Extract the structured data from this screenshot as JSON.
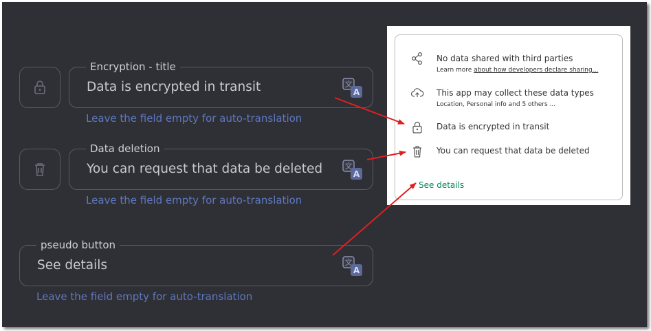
{
  "form": {
    "encryption": {
      "legend": "Encryption - title",
      "value": "Data is encrypted in transit",
      "hint": "Leave the field empty for auto-translation",
      "icon": "lock-icon"
    },
    "deletion": {
      "legend": "Data deletion",
      "value": "You can request that data be deleted",
      "hint": "Leave the field empty for auto-translation",
      "icon": "trash-icon"
    },
    "pseudo_button": {
      "legend": "pseudo button",
      "value": "See details",
      "hint": "Leave the field empty for auto-translation"
    },
    "translate_icon": "translate-icon"
  },
  "preview": {
    "rows": [
      {
        "icon": "share-icon",
        "title": "No data shared with third parties",
        "subtitle_prefix": "Learn more ",
        "subtitle_link": "about how developers declare sharing..."
      },
      {
        "icon": "cloud-upload-icon",
        "title": "This app may collect these data types",
        "subtitle": "Location, Personal info and 5 others ..."
      },
      {
        "icon": "lock-icon",
        "title": "Data is encrypted in transit"
      },
      {
        "icon": "trash-icon",
        "title": "You can request that data be deleted"
      }
    ],
    "see_details": "See details"
  },
  "colors": {
    "background": "#2f2f36",
    "field_border": "#5a5a63",
    "hint": "#5f79bf",
    "link_green": "#01875f",
    "arrow": "#e02020"
  }
}
